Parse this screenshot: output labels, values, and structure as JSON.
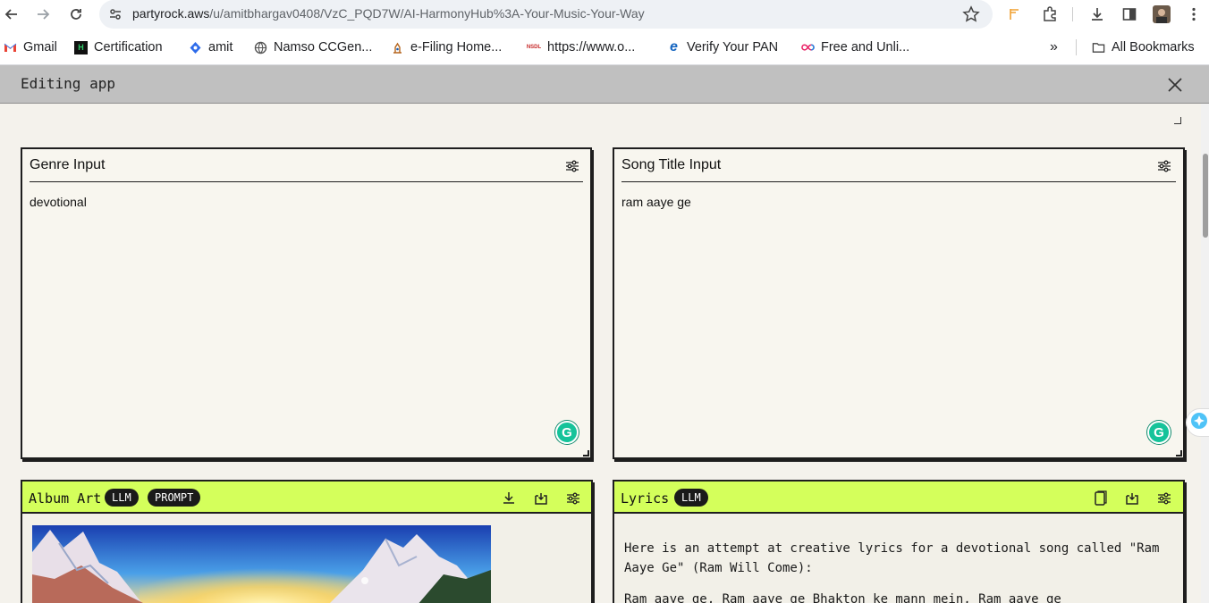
{
  "browser": {
    "url_host": "partyrock.aws",
    "url_path": "/u/amitbhargav0408/VzC_PQD7W/AI-HarmonyHub%3A-Your-Music-Your-Way"
  },
  "bookmarks": {
    "items": [
      {
        "label": "Gmail",
        "icon": "gmail-icon"
      },
      {
        "label": "Certification",
        "icon": "hackerrank-icon"
      },
      {
        "label": "amit",
        "icon": "diamond-icon"
      },
      {
        "label": "Namso CCGen...",
        "icon": "globe-icon"
      },
      {
        "label": "e-Filing Home...",
        "icon": "emblem-icon"
      },
      {
        "label": "https://www.o...",
        "icon": "nsdl-icon"
      },
      {
        "label": "Verify Your PAN",
        "icon": "e-icon"
      },
      {
        "label": "Free and Unli...",
        "icon": "infinity-icon"
      }
    ],
    "overflow": "»",
    "all_bookmarks": "All Bookmarks"
  },
  "editor": {
    "title": "Editing app"
  },
  "widgets": {
    "genre": {
      "title": "Genre Input",
      "value": "devotional"
    },
    "song_title": {
      "title": "Song Title Input",
      "value": "ram aaye ge"
    },
    "album_art": {
      "title": "Album Art",
      "badges": [
        "LLM",
        "PROMPT"
      ]
    },
    "lyrics": {
      "title": "Lyrics",
      "badge": "LLM",
      "paragraphs": [
        "Here is an attempt at creative lyrics for a devotional song called \"Ram Aaye Ge\" (Ram Will Come):",
        "Ram aaye ge, Ram aaye ge Bhakton ke mann mein, Ram aaye ge"
      ]
    }
  },
  "colors": {
    "accent_lime": "#d4ff5b",
    "header_gray": "#c0c0c0",
    "grammarly_green": "#15c39a"
  }
}
